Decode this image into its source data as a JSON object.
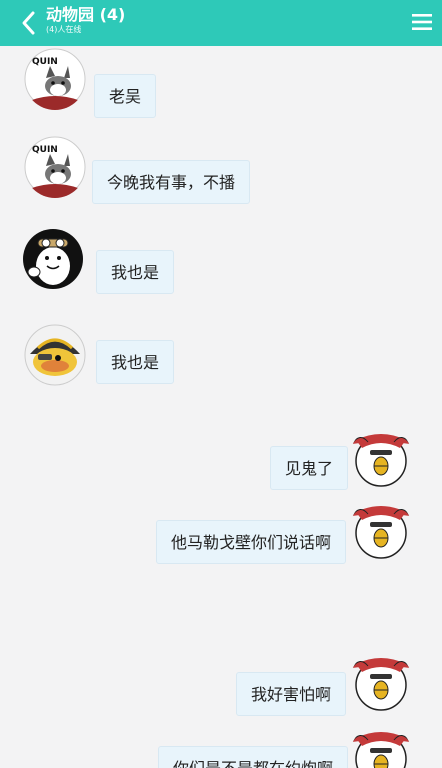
{
  "header": {
    "title": "动物园 (4)",
    "subtitle": "(4)人在线",
    "back_icon": "chevron-left-icon",
    "menu_icon": "hamburger-menu-icon",
    "color": "#2ec9b8"
  },
  "messages": [
    {
      "side": "left",
      "text": "老吴",
      "avatar": "husky-avatar",
      "avatar_text": "QUIN"
    },
    {
      "side": "left",
      "text": "今晚我有事，不播",
      "avatar": "husky-avatar",
      "avatar_text": "QUIN"
    },
    {
      "side": "left",
      "text": "我也是",
      "avatar": "goggles-creature-avatar"
    },
    {
      "side": "left",
      "text": "我也是",
      "avatar": "yellow-helmet-avatar"
    },
    {
      "side": "right",
      "text": "见鬼了",
      "avatar": "crested-bird-avatar"
    },
    {
      "side": "right",
      "text": "他马勒戈壁你们说话啊",
      "avatar": "crested-bird-avatar"
    },
    {
      "side": "right",
      "text": "我好害怕啊",
      "avatar": "crested-bird-avatar"
    },
    {
      "side": "right",
      "text": "你们是不是都在约炮啊",
      "avatar": "crested-bird-avatar"
    }
  ]
}
